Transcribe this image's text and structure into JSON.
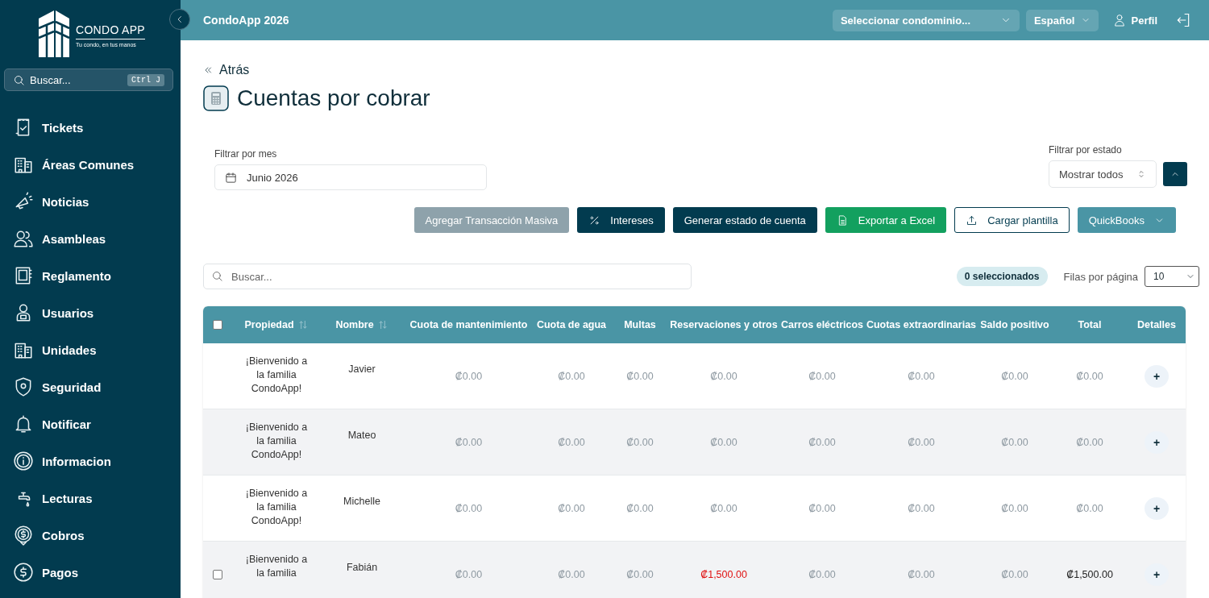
{
  "sidebar": {
    "logo": {
      "name": "CONDO APP",
      "tagline": "Tu condo, en tus manos"
    },
    "search": {
      "placeholder": "Buscar...",
      "shortcut": "Ctrl J"
    },
    "items": [
      {
        "label": "Tickets"
      },
      {
        "label": "Áreas Comunes"
      },
      {
        "label": "Noticias"
      },
      {
        "label": "Asambleas"
      },
      {
        "label": "Reglamento"
      },
      {
        "label": "Usuarios"
      },
      {
        "label": "Unidades"
      },
      {
        "label": "Seguridad"
      },
      {
        "label": "Notificar"
      },
      {
        "label": "Informacion"
      },
      {
        "label": "Lecturas"
      },
      {
        "label": "Cobros"
      },
      {
        "label": "Pagos"
      }
    ]
  },
  "topbar": {
    "title": "CondoApp 2026",
    "condo_select": "Seleccionar condominio...",
    "language": "Español",
    "profile": "Perfil"
  },
  "page": {
    "back": "Atrás",
    "title": "Cuentas por cobrar",
    "month_filter": {
      "label": "Filtrar por mes",
      "value": "Junio 2026"
    },
    "status_filter": {
      "label": "Filtrar por estado",
      "value": "Mostrar todos"
    },
    "buttons": [
      {
        "label": "Agregar Transacción Masiva",
        "kind": "muted"
      },
      {
        "label": "Intereses",
        "kind": "dark-percent"
      },
      {
        "label": "Generar estado de cuenta",
        "kind": "dark"
      },
      {
        "label": "Exportar a Excel",
        "kind": "excel"
      },
      {
        "label": "Cargar plantilla",
        "kind": "upload"
      },
      {
        "label": "QuickBooks",
        "kind": "dropdown"
      }
    ],
    "search": {
      "placeholder": "Buscar..."
    },
    "selected_count": "0 seleccionados",
    "rows_per_page": {
      "label": "Filas por página",
      "value": "10"
    }
  },
  "table": {
    "select_all_checked": false,
    "columns": [
      {
        "label": "Propiedad",
        "sortable": true
      },
      {
        "label": "Nombre",
        "sortable": true
      },
      {
        "label": "Cuota de mantenimiento",
        "sortable": false
      },
      {
        "label": "Cuota de agua",
        "sortable": false
      },
      {
        "label": "Multas",
        "sortable": false
      },
      {
        "label": "Reservaciones y otros",
        "sortable": false
      },
      {
        "label": "Carros eléctricos",
        "sortable": false
      },
      {
        "label": "Cuotas extraordinarias",
        "sortable": false
      },
      {
        "label": "Saldo positivo",
        "sortable": false
      },
      {
        "label": "Total",
        "sortable": false
      },
      {
        "label": "Detalles",
        "sortable": false
      }
    ],
    "rows": [
      {
        "kind": "plain",
        "property": "¡Bienvenido a la familia CondoApp!",
        "name": "Javier",
        "values": [
          {
            "text": "₡0.00",
            "kind": "zero"
          },
          {
            "text": "₡0.00",
            "kind": "zero"
          },
          {
            "text": "₡0.00",
            "kind": "zero"
          },
          {
            "text": "₡0.00",
            "kind": "zero"
          },
          {
            "text": "₡0.00",
            "kind": "zero"
          },
          {
            "text": "₡0.00",
            "kind": "zero"
          },
          {
            "text": "₡0.00",
            "kind": "zero"
          },
          {
            "text": "₡0.00",
            "kind": "zero"
          }
        ],
        "details": "+"
      },
      {
        "kind": "plain",
        "property": "¡Bienvenido a la familia CondoApp!",
        "name": "Mateo",
        "values": [
          {
            "text": "₡0.00",
            "kind": "zero"
          },
          {
            "text": "₡0.00",
            "kind": "zero"
          },
          {
            "text": "₡0.00",
            "kind": "zero"
          },
          {
            "text": "₡0.00",
            "kind": "zero"
          },
          {
            "text": "₡0.00",
            "kind": "zero"
          },
          {
            "text": "₡0.00",
            "kind": "zero"
          },
          {
            "text": "₡0.00",
            "kind": "zero"
          },
          {
            "text": "₡0.00",
            "kind": "zero"
          }
        ],
        "details": "+"
      },
      {
        "kind": "plain",
        "property": "¡Bienvenido a la familia CondoApp!",
        "name": "Michelle",
        "values": [
          {
            "text": "₡0.00",
            "kind": "zero"
          },
          {
            "text": "₡0.00",
            "kind": "zero"
          },
          {
            "text": "₡0.00",
            "kind": "zero"
          },
          {
            "text": "₡0.00",
            "kind": "zero"
          },
          {
            "text": "₡0.00",
            "kind": "zero"
          },
          {
            "text": "₡0.00",
            "kind": "zero"
          },
          {
            "text": "₡0.00",
            "kind": "zero"
          },
          {
            "text": "₡0.00",
            "kind": "zero"
          }
        ],
        "details": "+"
      },
      {
        "kind": "checkable",
        "checked": false,
        "property": "¡Bienvenido a la familia",
        "name": "Fabián",
        "values": [
          {
            "text": "₡0.00",
            "kind": "zero"
          },
          {
            "text": "₡0.00",
            "kind": "zero"
          },
          {
            "text": "₡0.00",
            "kind": "zero"
          },
          {
            "text": "₡1,500.00",
            "kind": "charge"
          },
          {
            "text": "₡0.00",
            "kind": "zero"
          },
          {
            "text": "₡0.00",
            "kind": "zero"
          },
          {
            "text": "₡0.00",
            "kind": "zero"
          },
          {
            "text": "₡1,500.00",
            "kind": "total"
          }
        ],
        "details": "+"
      }
    ]
  }
}
